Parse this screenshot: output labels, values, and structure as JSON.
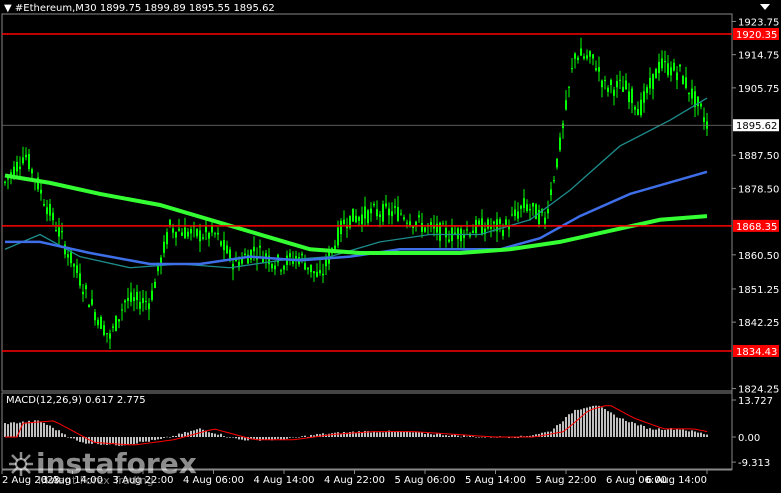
{
  "header": {
    "symbol_label": "#Ethereum,M30",
    "ohlc": "1899.75 1899.89 1895.55 1895.62"
  },
  "macd": {
    "label": "MACD(12,26,9) 0.617 2.775",
    "ticks": [
      "13.727",
      "0.00",
      "-9.313"
    ]
  },
  "price_axis": {
    "ticks": [
      "1923.75",
      "1914.75",
      "1905.75",
      "1887.50",
      "1878.50",
      "1860.50",
      "1851.25",
      "1842.25",
      "1824.25"
    ]
  },
  "price_levels": [
    {
      "label": "1920.35",
      "color": "#ff0000"
    },
    {
      "label": "1868.35",
      "color": "#ff0000"
    },
    {
      "label": "1834.43",
      "color": "#ff0000"
    }
  ],
  "current_price": {
    "label": "1895.62"
  },
  "time_axis": {
    "labels": [
      "2 Aug 2023",
      "3 Aug 14:00",
      "3 Aug 22:00",
      "4 Aug 06:00",
      "4 Aug 14:00",
      "4 Aug 22:00",
      "5 Aug 06:00",
      "5 Aug 14:00",
      "5 Aug 22:00",
      "6 Aug 06:00",
      "6 Aug 14:00"
    ]
  },
  "watermark": {
    "name": "instaforex",
    "tagline": "Instant Forex Trading"
  },
  "colors": {
    "candle": "#00ff00",
    "ma_fast": "#1e8c8c",
    "ma_mid": "#3f6fe8",
    "ma_slow": "#33ff33",
    "macd_hist": "#c0c0c0",
    "macd_signal": "#ff0000",
    "level": "#ff0000"
  }
}
